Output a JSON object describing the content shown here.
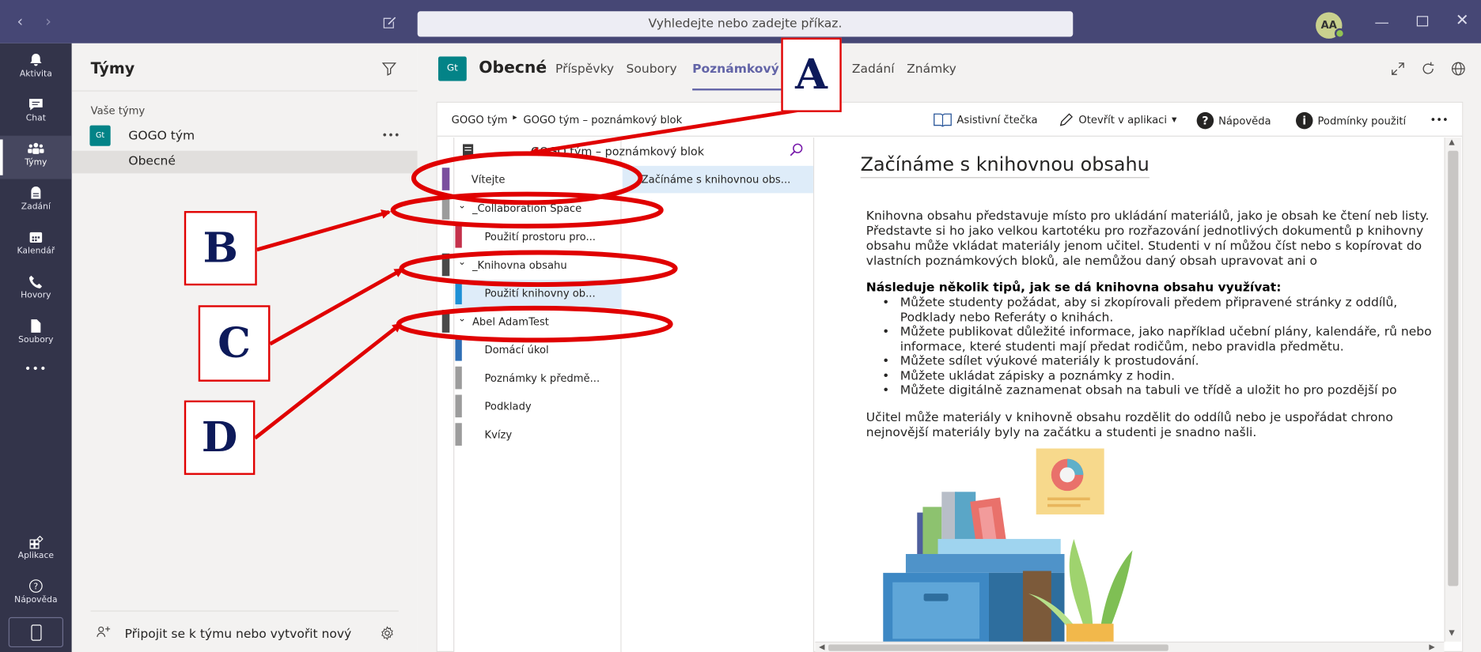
{
  "search": {
    "placeholder": "Vyhledejte nebo zadejte příkaz."
  },
  "user": {
    "initials": "AA"
  },
  "rail": {
    "items": [
      {
        "label": "Aktivita",
        "icon": "bell-icon"
      },
      {
        "label": "Chat",
        "icon": "chat-icon"
      },
      {
        "label": "Týmy",
        "icon": "teams-icon"
      },
      {
        "label": "Zadání",
        "icon": "assignments-icon"
      },
      {
        "label": "Kalendář",
        "icon": "calendar-icon"
      },
      {
        "label": "Hovory",
        "icon": "phone-icon"
      },
      {
        "label": "Soubory",
        "icon": "files-icon"
      },
      {
        "label": "Aplikace",
        "icon": "apps-icon"
      },
      {
        "label": "Nápověda",
        "icon": "help-icon"
      }
    ],
    "more": "•••"
  },
  "teams": {
    "title": "Týmy",
    "section": "Vaše týmy",
    "team": {
      "badge": "Gt",
      "name": "GOGO tým",
      "more": "•••"
    },
    "channel": "Obecné",
    "join": "Připojit se k týmu nebo vytvořit nový"
  },
  "channel": {
    "badge": "Gt",
    "name": "Obecné",
    "tabs": [
      "Příspěvky",
      "Soubory",
      "Poznámkový blok",
      "Zadání",
      "Známky"
    ]
  },
  "onenote": {
    "breadcrumb": {
      "team": "GOGO tým",
      "notebook": "GOGO tým – poznámkový blok"
    },
    "toolbar": {
      "reader": "Asistivní čtečka",
      "open": "Otevřít v aplikaci",
      "help": "Nápověda",
      "terms": "Podmínky použití",
      "more": "•••"
    },
    "notebook_title": "GOGO tým – poznámkový blok",
    "sections": [
      {
        "label": "Vítejte",
        "color": "#7b4f9e"
      },
      {
        "label": "_Collaboration Space",
        "color": "#9c9c9c",
        "group": true
      },
      {
        "label": "Použití prostoru pro...",
        "color": "#c4314b"
      },
      {
        "label": "_Knihovna obsahu",
        "color": "#4a4a4a",
        "group": true
      },
      {
        "label": "Použití knihovny ob...",
        "color": "#1e90d6"
      },
      {
        "label": "Abel AdamTest",
        "color": "#4a4a4a",
        "group": true
      },
      {
        "label": "Domácí úkol",
        "color": "#2f6fb5"
      },
      {
        "label": "Poznámky k předmě...",
        "color": "#9c9c9c"
      },
      {
        "label": "Podklady",
        "color": "#9c9c9c"
      },
      {
        "label": "Kvízy",
        "color": "#9c9c9c"
      }
    ],
    "page": "Začínáme s knihovnou obs...",
    "content": {
      "title": "Začínáme s knihovnou obsahu",
      "p1": "Knihovna obsahu představuje místo pro ukládání materiálů, jako je obsah ke čtení neb listy. Představte si ho jako velkou kartotéku pro rozřazování jednotlivých dokumentů p knihovny obsahu může vkládat materiály jenom učitel. Studenti v ní můžou číst nebo s kopírovat do vlastních poznámkových bloků, ale nemůžou daný obsah upravovat ani o",
      "tips_title": "Následuje několik tipů, jak se dá knihovna obsahu využívat:",
      "tips": [
        "Můžete studenty požádat, aby si zkopírovali předem připravené stránky z oddílů, Podklady nebo Referáty o knihách.",
        "Můžete publikovat důležité informace, jako například učební plány, kalendáře, rů nebo informace, které studenti mají předat rodičům, nebo pravidla předmětu.",
        "Můžete sdílet výukové materiály k prostudování.",
        "Můžete ukládat zápisky a poznámky z hodin.",
        "Můžete digitálně zaznamenat obsah na tabuli ve třídě a uložit ho pro pozdější po"
      ],
      "p2": "Učitel může materiály v knihovně obsahu rozdělit do oddílů nebo je uspořádat chrono nejnovější materiály byly na začátku a studenti je snadno našli."
    }
  },
  "annotations": [
    "A",
    "B",
    "C",
    "D"
  ],
  "colors": {
    "accent": "#6264a7",
    "title_bar": "#464775",
    "rail": "#33344a",
    "annotation": "#e00000",
    "badge": "#038387"
  }
}
